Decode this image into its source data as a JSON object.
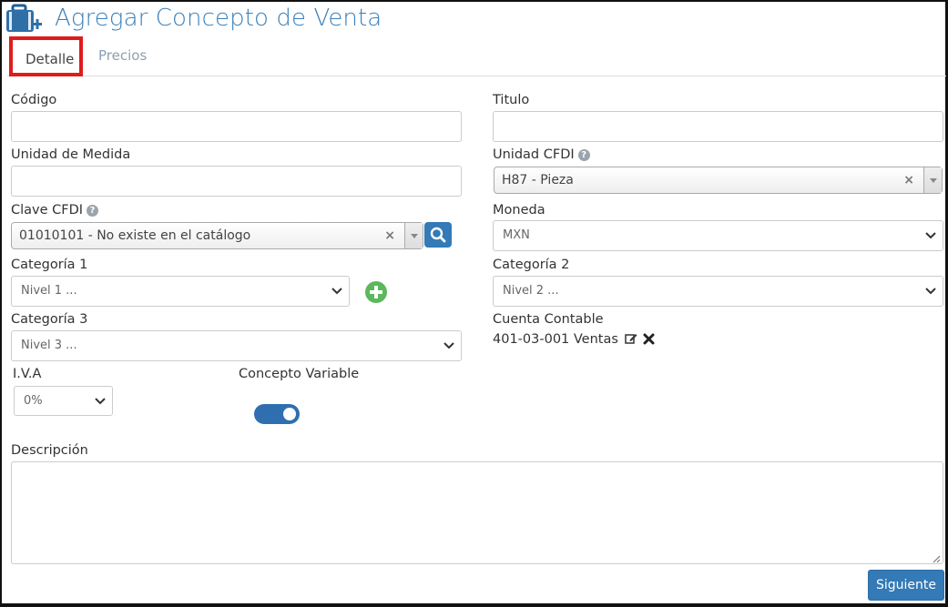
{
  "header": {
    "title": "Agregar Concepto de Venta",
    "icon": "briefcase-add-icon"
  },
  "tabs": [
    {
      "label": "Detalle",
      "active": true
    },
    {
      "label": "Precios",
      "active": false
    }
  ],
  "form": {
    "codigo": {
      "label": "Código",
      "value": ""
    },
    "titulo": {
      "label": "Titulo",
      "value": ""
    },
    "unidad_medida": {
      "label": "Unidad de Medida",
      "value": ""
    },
    "unidad_cfdi": {
      "label": "Unidad CFDI",
      "value": "H87 - Pieza"
    },
    "clave_cfdi": {
      "label": "Clave CFDI",
      "value": "01010101 - No existe en el catálogo"
    },
    "moneda": {
      "label": "Moneda",
      "value": "MXN"
    },
    "categoria1": {
      "label": "Categoría 1",
      "value": "Nivel 1 ..."
    },
    "categoria2": {
      "label": "Categoría 2",
      "value": "Nivel 2 ..."
    },
    "categoria3": {
      "label": "Categoría 3",
      "value": "Nivel 3 ..."
    },
    "cuenta_contable": {
      "label": "Cuenta Contable",
      "value": "401-03-001 Ventas"
    },
    "iva": {
      "label": "I.V.A",
      "value": "0%"
    },
    "concepto_variable": {
      "label": "Concepto Variable",
      "on": true
    },
    "descripcion": {
      "label": "Descripción",
      "value": ""
    }
  },
  "actions": {
    "next_label": "Siguiente"
  },
  "colors": {
    "accent": "#337ab7",
    "title": "#3a80bb",
    "highlight": "#e01b1b",
    "add": "#5cb85c"
  }
}
